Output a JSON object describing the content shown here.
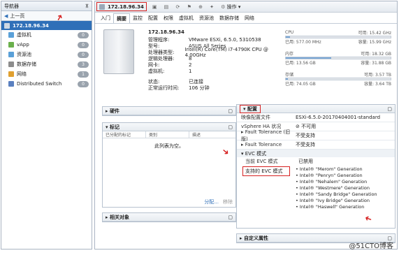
{
  "nav": {
    "title": "导航器",
    "pin": "⊼",
    "back": "上一页",
    "host": "172.18.96.34",
    "items": [
      {
        "label": "虚拟机",
        "count": "0",
        "icon_color": "#5aa0d8"
      },
      {
        "label": "vApp",
        "count": "0",
        "icon_color": "#6ab04c"
      },
      {
        "label": "资源池",
        "count": "0",
        "icon_color": "#5aa0d8"
      },
      {
        "label": "数据存储",
        "count": "3",
        "icon_color": "#8c8c8c"
      },
      {
        "label": "网络",
        "count": "1",
        "icon_color": "#e0a030"
      },
      {
        "label": "Distributed Switch",
        "count": "0",
        "icon_color": "#5a80c0"
      }
    ]
  },
  "toolbar": {
    "host": "172.18.96.34",
    "actions": "操作",
    "actions_icon": "gear-icon"
  },
  "tabs": [
    "入门",
    "摘要",
    "监控",
    "配置",
    "权限",
    "虚拟机",
    "资源池",
    "数据存储",
    "网络"
  ],
  "summary": {
    "host": "172.18.96.34",
    "rows": [
      {
        "k": "管理程序:",
        "v": "VMware ESXi, 6.5.0, 5310538"
      },
      {
        "k": "型号:",
        "v": "ASUS All Series"
      },
      {
        "k": "处理器类型:",
        "v": "Intel(R) Core(TM) i7-4790K CPU @ 4.00GHz"
      },
      {
        "k": "逻辑处理器:",
        "v": "8"
      },
      {
        "k": "网卡:",
        "v": "2"
      },
      {
        "k": "虚拟机:",
        "v": "1"
      }
    ],
    "rows2": [
      {
        "k": "状态:",
        "v": "已连接"
      },
      {
        "k": "正常运行时间:",
        "v": "106 分钟"
      }
    ]
  },
  "resources": {
    "cpu": {
      "label": "CPU",
      "free": "可用: 15.42 GHz",
      "used": "已用: 577.00 MHz",
      "cap": "容量: 15.99 GHz",
      "fill": 0.04
    },
    "mem": {
      "label": "内存",
      "free": "可用: 18.32 GB",
      "used": "已用: 13.56 GB",
      "cap": "容量: 31.88 GB",
      "fill": 0.43
    },
    "sto": {
      "label": "存储",
      "free": "可用: 3.57 TB",
      "used": "已用: 74.05 GB",
      "cap": "容量: 3.64 TB",
      "fill": 0.02
    }
  },
  "panels": {
    "hardware": "硬件",
    "tags": "标记",
    "tags_cols": [
      "已分配的标记",
      "类别",
      "描述"
    ],
    "tags_empty": "此列表为空。",
    "tags_footer": "分配...",
    "tags_remove": "移除",
    "related": "相关对象",
    "config": "配置",
    "custom": "自定义属性"
  },
  "config": {
    "rows": [
      {
        "k": "映像配置文件",
        "v": "ESXi-6.5.0-20170404001-standard"
      },
      {
        "k": "vSphere HA 状况",
        "v": "⊘ 不可用"
      },
      {
        "k": "▸ Fault Tolerance (旧版)",
        "v": "不受支持"
      },
      {
        "k": "▸ Fault Tolerance",
        "v": "不受支持"
      }
    ],
    "evc_title": "▾ EVC 模式",
    "evc_current_k": "当前 EVC 模式",
    "evc_current_v": "已禁用",
    "evc_supported_k": "支持的 EVC 模式",
    "evc_modes": [
      "• Intel® \"Merom\" Generation",
      "• Intel® \"Penryn\" Generation",
      "• Intel® \"Nehalem\" Generation",
      "• Intel® \"Westmere\" Generation",
      "• Intel® \"Sandy Bridge\" Generation",
      "• Intel® \"Ivy Bridge\" Generation",
      "• Intel® \"Haswell\" Generation"
    ]
  },
  "watermark": "@51CTO博客"
}
